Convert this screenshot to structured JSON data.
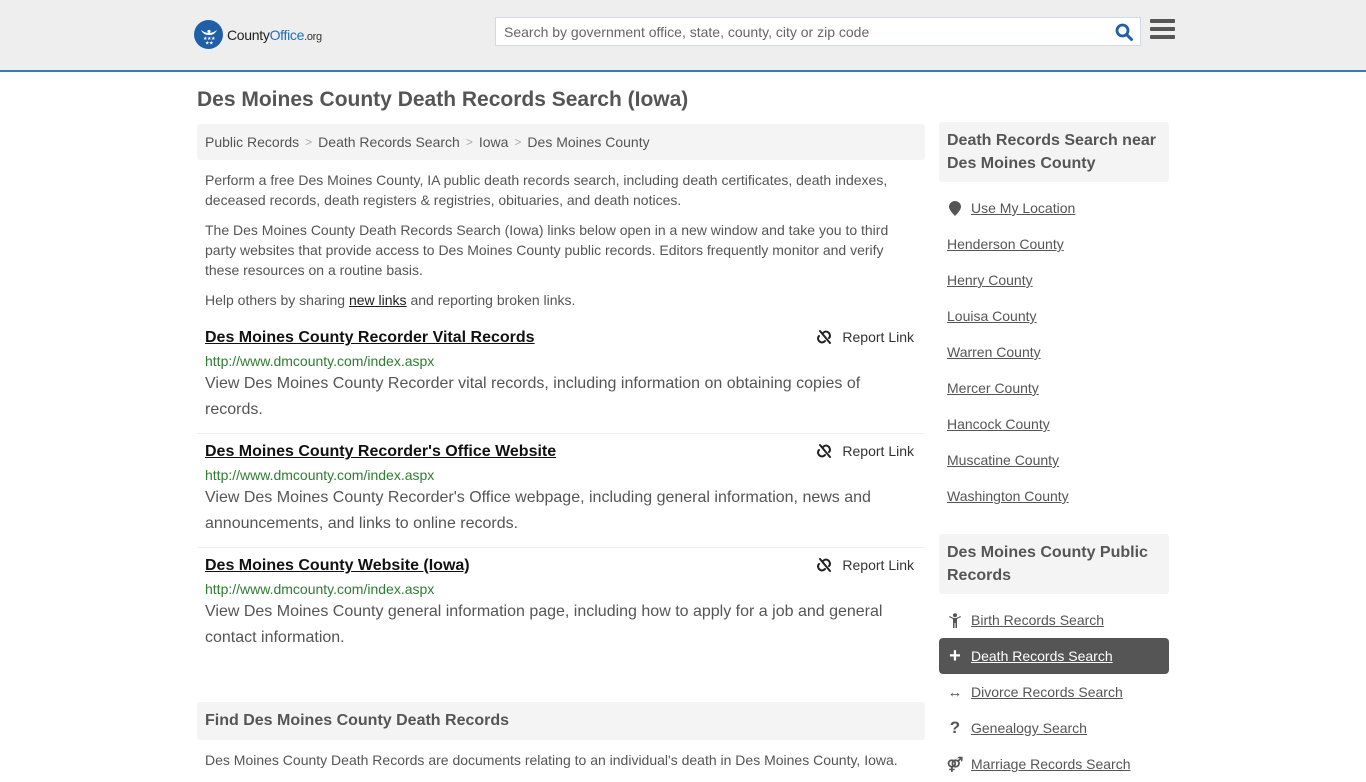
{
  "header": {
    "logo": {
      "brand_part1": "County",
      "brand_part2": "Office",
      "brand_suffix": ".org"
    },
    "search": {
      "placeholder": "Search by government office, state, county, city or zip code",
      "value": ""
    },
    "icons": {
      "search": "search-icon",
      "menu": "hamburger-menu-icon"
    }
  },
  "page": {
    "title": "Des Moines County Death Records Search (Iowa)",
    "breadcrumb": [
      "Public Records",
      "Death Records Search",
      "Iowa",
      "Des Moines County"
    ],
    "intro": {
      "p1": "Perform a free Des Moines County, IA public death records search, including death certificates, death indexes, deceased records, death registers & registries, obituaries, and death notices.",
      "p2": "The Des Moines County Death Records Search (Iowa) links below open in a new window and take you to third party websites that provide access to Des Moines County public records. Editors frequently monitor and verify these resources on a routine basis.",
      "p3_before": "Help others by sharing ",
      "p3_link": "new links",
      "p3_after": " and reporting broken links."
    },
    "results": [
      {
        "title": "Des Moines County Recorder Vital Records",
        "url": "http://www.dmcounty.com/index.aspx",
        "description": "View Des Moines County Recorder vital records, including information on obtaining copies of records.",
        "report_label": "Report Link"
      },
      {
        "title": "Des Moines County Recorder's Office Website",
        "url": "http://www.dmcounty.com/index.aspx",
        "description": "View Des Moines County Recorder's Office webpage, including general information, news and announcements, and links to online records.",
        "report_label": "Report Link"
      },
      {
        "title": "Des Moines County Website (Iowa)",
        "url": "http://www.dmcounty.com/index.aspx",
        "description": "View Des Moines County general information page, including how to apply for a job and general contact information.",
        "report_label": "Report Link"
      }
    ],
    "find_section": {
      "heading": "Find Des Moines County Death Records",
      "text": "Des Moines County Death Records are documents relating to an individual's death in Des Moines County, Iowa."
    }
  },
  "sidebar": {
    "nearby": {
      "heading": "Death Records Search near Des Moines County",
      "use_location": "Use My Location",
      "counties": [
        "Henderson County",
        "Henry County",
        "Louisa County",
        "Warren County",
        "Mercer County",
        "Hancock County",
        "Muscatine County",
        "Washington County"
      ]
    },
    "public_records": {
      "heading": "Des Moines County Public Records",
      "items": [
        {
          "label": "Birth Records Search",
          "icon": "child-icon",
          "glyph": "",
          "active": false
        },
        {
          "label": "Death Records Search",
          "icon": "plus-icon",
          "glyph": "+",
          "active": true
        },
        {
          "label": "Divorce Records Search",
          "icon": "arrows-horizontal-icon",
          "glyph": "↔",
          "active": false
        },
        {
          "label": "Genealogy Search",
          "icon": "question-icon",
          "glyph": "?",
          "active": false
        },
        {
          "label": "Marriage Records Search",
          "icon": "gender-icon",
          "glyph": "⚤",
          "active": false
        }
      ]
    }
  },
  "colors": {
    "header_bg": "#eeeeee",
    "header_border": "#337ab7",
    "brand_blue": "#1f5fa8",
    "url_green": "#2e7d32",
    "active_bg": "#555555",
    "panel_bg": "#f4f4f4"
  }
}
